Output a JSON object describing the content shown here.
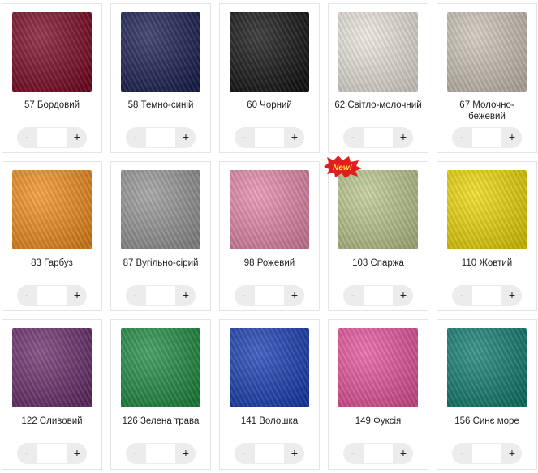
{
  "products": [
    {
      "label": "57 Бордовий",
      "color": "#7e0a24",
      "plus": "+",
      "minus": "-",
      "qty": ""
    },
    {
      "label": "58 Темно-синій",
      "color": "#1b1f55",
      "plus": "+",
      "minus": "-",
      "qty": ""
    },
    {
      "label": "60 Чорний",
      "color": "#141414",
      "plus": "+",
      "minus": "-",
      "qty": ""
    },
    {
      "label": "62 Світло-молочний",
      "color": "#ede9e0",
      "plus": "+",
      "minus": "-",
      "qty": ""
    },
    {
      "label": "67 Молочно-бежевий",
      "color": "#cfc6ba",
      "plus": "+",
      "minus": "-",
      "qty": ""
    },
    {
      "label": "83 Гарбуз",
      "color": "#f5901e",
      "plus": "+",
      "minus": "-",
      "qty": ""
    },
    {
      "label": "87 Вугільно-сірий",
      "color": "#9a9898",
      "plus": "+",
      "minus": "-",
      "qty": ""
    },
    {
      "label": "98 Рожевий",
      "color": "#e88aae",
      "plus": "+",
      "minus": "-",
      "qty": ""
    },
    {
      "label": "103 Спаржа",
      "color": "#bccb8e",
      "plus": "+",
      "minus": "-",
      "qty": "",
      "badge": "New!"
    },
    {
      "label": "110 Жовтий",
      "color": "#f1db0a",
      "plus": "+",
      "minus": "-",
      "qty": ""
    },
    {
      "label": "122 Сливовий",
      "color": "#6d2f6e",
      "plus": "+",
      "minus": "-",
      "qty": ""
    },
    {
      "label": "126 Зелена трава",
      "color": "#1f8f43",
      "plus": "+",
      "minus": "-",
      "qty": ""
    },
    {
      "label": "141 Волошка",
      "color": "#1a3fb5",
      "plus": "+",
      "minus": "-",
      "qty": ""
    },
    {
      "label": "149 Фуксія",
      "color": "#e9569e",
      "plus": "+",
      "minus": "-",
      "qty": ""
    },
    {
      "label": "156 Синє море",
      "color": "#137f73",
      "plus": "+",
      "minus": "-",
      "qty": ""
    }
  ]
}
